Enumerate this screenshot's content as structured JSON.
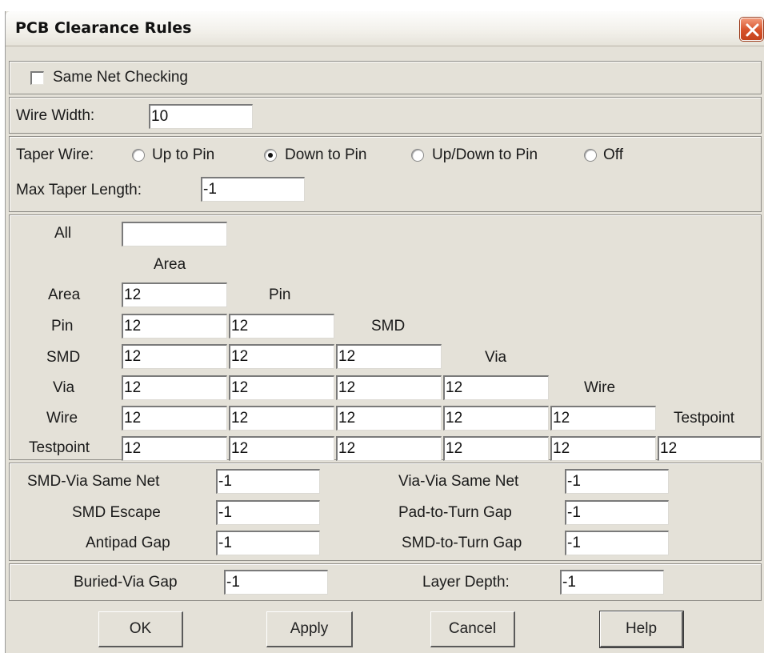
{
  "window": {
    "title": "PCB Clearance Rules"
  },
  "same_net": {
    "label": "Same Net Checking",
    "checked": false
  },
  "wire_width": {
    "label": "Wire Width:",
    "value": "10"
  },
  "taper": {
    "label": "Taper Wire:",
    "options": [
      "Up to Pin",
      "Down to Pin",
      "Up/Down to Pin",
      "Off"
    ],
    "selected": "Down to Pin",
    "max_length_label": "Max Taper Length:",
    "max_length_value": "-1"
  },
  "matrix": {
    "all_label": "All",
    "all_value": "",
    "columns": [
      "Area",
      "Pin",
      "SMD",
      "Via",
      "Wire",
      "Testpoint"
    ],
    "rows": [
      {
        "label": "Area",
        "values": [
          "12"
        ]
      },
      {
        "label": "Pin",
        "values": [
          "12",
          "12"
        ]
      },
      {
        "label": "SMD",
        "values": [
          "12",
          "12",
          "12"
        ]
      },
      {
        "label": "Via",
        "values": [
          "12",
          "12",
          "12",
          "12"
        ]
      },
      {
        "label": "Wire",
        "values": [
          "12",
          "12",
          "12",
          "12",
          "12"
        ]
      },
      {
        "label": "Testpoint",
        "values": [
          "12",
          "12",
          "12",
          "12",
          "12",
          "12"
        ]
      }
    ]
  },
  "gaps": {
    "smd_via_same_net": {
      "label": "SMD-Via Same Net",
      "value": "-1"
    },
    "smd_escape": {
      "label": "SMD Escape",
      "value": "-1"
    },
    "antipad_gap": {
      "label": "Antipad Gap",
      "value": "-1"
    },
    "via_via_same_net": {
      "label": "Via-Via Same Net",
      "value": "-1"
    },
    "pad_to_turn_gap": {
      "label": "Pad-to-Turn Gap",
      "value": "-1"
    },
    "smd_to_turn_gap": {
      "label": "SMD-to-Turn Gap",
      "value": "-1"
    }
  },
  "buried": {
    "buried_via_gap": {
      "label": "Buried-Via Gap",
      "value": "-1"
    },
    "layer_depth": {
      "label": "Layer Depth:",
      "value": "-1"
    }
  },
  "buttons": {
    "ok": "OK",
    "apply": "Apply",
    "cancel": "Cancel",
    "help": "Help"
  },
  "colors": {
    "dialog_bg": "#e4e1d8",
    "close_button": "#d6522a"
  }
}
